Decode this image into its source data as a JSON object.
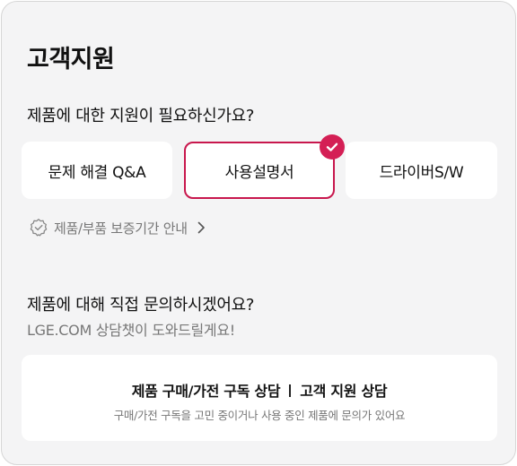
{
  "section": {
    "title": "고객지원",
    "question": "제품에 대한 지원이 필요하신가요?"
  },
  "options": [
    {
      "label": "문제 해결 Q&A",
      "selected": false
    },
    {
      "label": "사용설명서",
      "selected": true
    },
    {
      "label": "드라이버S/W",
      "selected": false
    }
  ],
  "warranty_link": {
    "label": "제품/부품 보증기간 안내",
    "icon": "badge-icon"
  },
  "inquiry": {
    "question": "제품에 대해 직접 문의하시겠어요?",
    "subtitle": "LGE.COM 상담챗이 도와드릴게요!"
  },
  "consult": {
    "left_label": "제품 구매/가전 구독 상담",
    "right_label": "고객 지원 상담",
    "description": "구매/가전 구독을 고민 중이거나 사용 중인 제품에 문의가 있어요"
  },
  "colors": {
    "accent": "#d41f55",
    "selected_border": "#c8174d",
    "card_background": "#f4f4f5",
    "muted_text": "#777777"
  }
}
